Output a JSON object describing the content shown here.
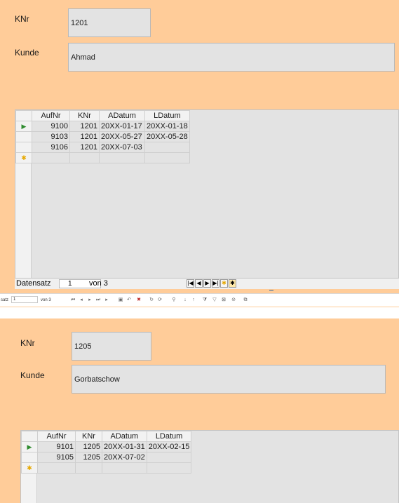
{
  "form1": {
    "knr_label": "KNr",
    "knr_value": "1201",
    "kunde_label": "Kunde",
    "kunde_value": "Ahmad",
    "grid": {
      "columns": [
        "AufNr",
        "KNr",
        "ADatum",
        "LDatum"
      ],
      "rows": [
        {
          "aufnr": "9100",
          "knr": "1201",
          "adatum": "20XX-01-17",
          "ldatum": "20XX-01-18"
        },
        {
          "aufnr": "9103",
          "knr": "1201",
          "adatum": "20XX-05-27",
          "ldatum": "20XX-05-28"
        },
        {
          "aufnr": "9106",
          "knr": "1201",
          "adatum": "20XX-07-03",
          "ldatum": ""
        }
      ]
    },
    "nav": {
      "label": "Datensatz",
      "current": "1",
      "total": "von 3"
    }
  },
  "toolbar": {
    "label": "satz",
    "current": "1",
    "total": "von 3"
  },
  "form2": {
    "knr_label": "KNr",
    "knr_value": "1205",
    "kunde_label": "Kunde",
    "kunde_value": "Gorbatschow",
    "grid": {
      "columns": [
        "AufNr",
        "KNr",
        "ADatum",
        "LDatum"
      ],
      "rows": [
        {
          "aufnr": "9101",
          "knr": "1205",
          "adatum": "20XX-01-31",
          "ldatum": "20XX-02-15"
        },
        {
          "aufnr": "9105",
          "knr": "1205",
          "adatum": "20XX-07-02",
          "ldatum": ""
        }
      ]
    }
  },
  "icons": {
    "current_row": "play-triangle-icon",
    "new_row": "asterisk-icon",
    "accent_green": "#2e8b2e",
    "accent_yellow": "#e6a800"
  }
}
